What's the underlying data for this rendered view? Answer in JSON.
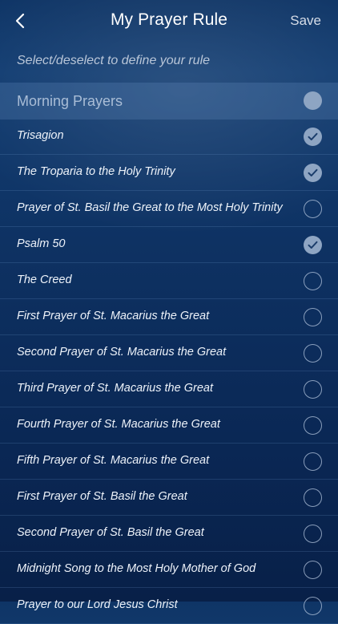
{
  "header": {
    "title": "My Prayer Rule",
    "save_label": "Save",
    "back_icon": "chevron-left-icon"
  },
  "instruction": "Select/deselect to define your rule",
  "section": {
    "title": "Morning Prayers",
    "selected": "partial"
  },
  "prayers": [
    {
      "label": "Trisagion",
      "selected": true
    },
    {
      "label": "The Troparia to the Holy Trinity",
      "selected": true
    },
    {
      "label": "Prayer of St. Basil the Great to the Most Holy Trinity",
      "selected": false
    },
    {
      "label": "Psalm 50",
      "selected": true
    },
    {
      "label": "The Creed",
      "selected": false
    },
    {
      "label": "First Prayer of St. Macarius the Great",
      "selected": false
    },
    {
      "label": "Second Prayer of St. Macarius the Great",
      "selected": false
    },
    {
      "label": "Third Prayer of St. Macarius the Great",
      "selected": false
    },
    {
      "label": "Fourth Prayer of St. Macarius the Great",
      "selected": false
    },
    {
      "label": "Fifth Prayer of St. Macarius the Great",
      "selected": false
    },
    {
      "label": "First Prayer of St. Basil the Great",
      "selected": false
    },
    {
      "label": "Second Prayer of St. Basil the Great",
      "selected": false
    },
    {
      "label": "Midnight Song to the Most Holy Mother of God",
      "selected": false
    },
    {
      "label": "Prayer to our Lord Jesus Christ",
      "selected": false
    }
  ],
  "colors": {
    "background_top": "#123d72",
    "background_bottom": "#082048",
    "check_fill": "#8ea5c3",
    "check_mark": "#1b3d6b"
  }
}
